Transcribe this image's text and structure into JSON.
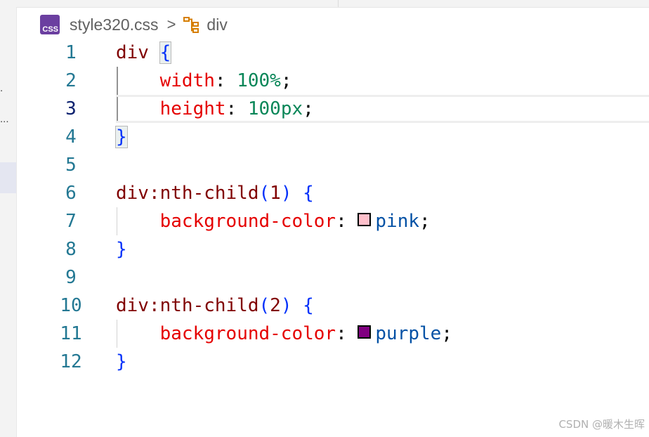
{
  "breadcrumb": {
    "file_icon": "css-file-icon",
    "file_icon_text": "CSS",
    "file_name": "style320.css",
    "separator": ">",
    "symbol_icon": "element-structure-icon",
    "symbol_name": "div"
  },
  "sidebar": {
    "dots_1": ".",
    "dots_2": "..."
  },
  "editor": {
    "current_line": 3,
    "lines": [
      {
        "number": "1",
        "tokens": [
          {
            "text": "div ",
            "t": "selector"
          },
          {
            "text": "{",
            "t": "brace"
          }
        ]
      },
      {
        "number": "2",
        "tokens": [
          {
            "text": "width",
            "t": "property"
          },
          {
            "text": ": ",
            "t": "punct"
          },
          {
            "text": "100%",
            "t": "number"
          },
          {
            "text": ";",
            "t": "punct"
          }
        ]
      },
      {
        "number": "3",
        "tokens": [
          {
            "text": "height",
            "t": "property"
          },
          {
            "text": ": ",
            "t": "punct"
          },
          {
            "text": "100px",
            "t": "number"
          },
          {
            "text": ";",
            "t": "punct"
          }
        ]
      },
      {
        "number": "4",
        "tokens": [
          {
            "text": "}",
            "t": "brace"
          }
        ]
      },
      {
        "number": "5",
        "tokens": []
      },
      {
        "number": "6",
        "tokens": [
          {
            "text": "div:nth-child",
            "t": "selector"
          },
          {
            "text": "(",
            "t": "brace"
          },
          {
            "text": "1",
            "t": "selector"
          },
          {
            "text": ") ",
            "t": "brace"
          },
          {
            "text": "{",
            "t": "brace"
          }
        ]
      },
      {
        "number": "7",
        "tokens": [
          {
            "text": "background-color",
            "t": "property"
          },
          {
            "text": ": ",
            "t": "punct"
          },
          {
            "swatch": "#ffc0cb"
          },
          {
            "text": "pink",
            "t": "keyword"
          },
          {
            "text": ";",
            "t": "punct"
          }
        ]
      },
      {
        "number": "8",
        "tokens": [
          {
            "text": "}",
            "t": "brace"
          }
        ]
      },
      {
        "number": "9",
        "tokens": []
      },
      {
        "number": "10",
        "tokens": [
          {
            "text": "div:nth-child",
            "t": "selector"
          },
          {
            "text": "(",
            "t": "brace"
          },
          {
            "text": "2",
            "t": "selector"
          },
          {
            "text": ") ",
            "t": "brace"
          },
          {
            "text": "{",
            "t": "brace"
          }
        ]
      },
      {
        "number": "11",
        "tokens": [
          {
            "text": "background-color",
            "t": "property"
          },
          {
            "text": ": ",
            "t": "punct"
          },
          {
            "swatch": "#800080"
          },
          {
            "text": "purple",
            "t": "keyword"
          },
          {
            "text": ";",
            "t": "punct"
          }
        ]
      },
      {
        "number": "12",
        "tokens": [
          {
            "text": "}",
            "t": "brace"
          }
        ]
      }
    ]
  },
  "colors": {
    "selector": "#800000",
    "property": "#e50000",
    "number": "#098658",
    "keyword": "#0451a5",
    "brace": "#0431fa",
    "line_number": "#237893",
    "css_icon_bg": "#6b3fa0"
  },
  "watermark": "CSDN @暖木生晖"
}
